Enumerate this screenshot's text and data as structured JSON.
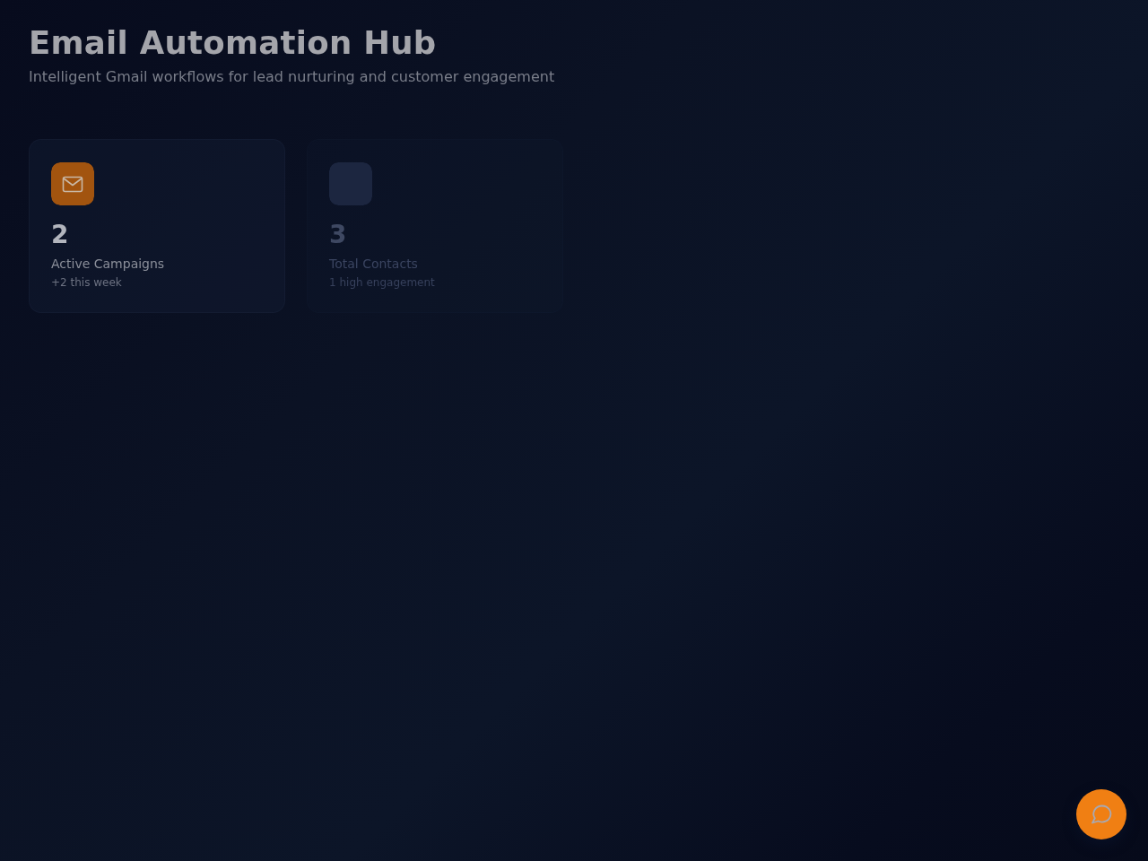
{
  "header": {
    "title": "Email Automation Hub",
    "subtitle": "Intelligent Gmail workflows for lead nurturing and customer engagement"
  },
  "stats": [
    {
      "value": "2",
      "label": "Active Campaigns",
      "note": "+2 this week",
      "dimmed": false
    },
    {
      "value": "3",
      "label": "Total Contacts",
      "note": "1 high engagement",
      "dimmed": true
    }
  ]
}
